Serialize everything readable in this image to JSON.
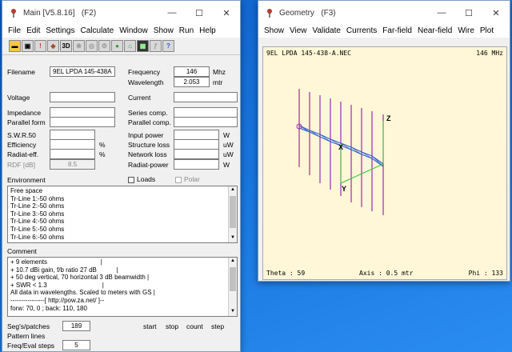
{
  "main": {
    "title": "Main [V5.8.16]",
    "shortcut": "(F2)",
    "menu": [
      "File",
      "Edit",
      "Settings",
      "Calculate",
      "Window",
      "Show",
      "Run",
      "Help"
    ],
    "toolbar_icons": [
      "open-icon",
      "save-icon",
      "info-icon",
      "snapshot-icon",
      "3d-icon",
      "pattern-icon",
      "sweep-icon",
      "gear-icon",
      "sphere-icon",
      "home-icon",
      "grid-icon",
      "tool-icon",
      "help-icon"
    ],
    "toolbar_3d_label": "3D",
    "filename_label": "Filename",
    "filename_value": "9EL LPDA 145-438A",
    "frequency_label": "Frequency",
    "frequency_value": "146",
    "frequency_unit": "Mhz",
    "wavelength_label": "Wavelength",
    "wavelength_value": "2.053",
    "wavelength_unit": "mtr",
    "voltage_label": "Voltage",
    "current_label": "Current",
    "impedance_label": "Impedance",
    "series_comp_label": "Series comp.",
    "parallel_form_label": "Parallel form",
    "parallel_comp_label": "Parallel comp.",
    "swr_label": "S.W.R.50",
    "input_power_label": "Input power",
    "input_power_unit": "W",
    "efficiency_label": "Efficiency",
    "efficiency_unit": "%",
    "structure_loss_label": "Structure loss",
    "structure_loss_unit": "uW",
    "radiat_eff_label": "Radiat-eff.",
    "radiat_eff_unit": "%",
    "network_loss_label": "Network loss",
    "network_loss_unit": "uW",
    "rdf_label": "RDF [dB]",
    "rdf_value": "8.5",
    "radiat_power_label": "Radiat-power",
    "radiat_power_unit": "W",
    "environment_label": "Environment",
    "loads_label": "Loads",
    "polar_label": "Polar",
    "environment_lines": [
      "Free space",
      "Tr-Line  1:-50 ohms",
      "Tr-Line  2:-50 ohms",
      "Tr-Line  3:-50 ohms",
      "Tr-Line  4:-50 ohms",
      "Tr-Line  5:-50 ohms",
      "Tr-Line  6:-50 ohms"
    ],
    "comment_label": "Comment",
    "comment_lines": [
      "+ 9 elements                              |",
      "+ 10.7 dBi gain, f/b ratio 27 dB           |",
      "+ 50 deg vertical, 70 horizontal 3 dB beamwidth |",
      "+ SWR < 1.3                               |",
      "All data in wavelengths. Scaled to meters with GS |",
      "----------------[ http://pow.za.net/ ]--",
      "forw: 70, 0 ; back: 110, 180"
    ],
    "segs_label": "Seg's/patches",
    "segs_value": "189",
    "pattern_lines_label": "Pattern lines",
    "freq_eval_label": "Freq/Eval steps",
    "freq_eval_value": "5",
    "start_label": "start",
    "stop_label": "stop",
    "count_label": "count",
    "step_label": "step"
  },
  "geometry": {
    "title": "Geometry",
    "shortcut": "(F3)",
    "menu": [
      "Show",
      "View",
      "Validate",
      "Currents",
      "Far-field",
      "Near-field",
      "Wire",
      "Plot"
    ],
    "canvas_title": "9EL LPDA 145-438-A.NEC",
    "canvas_freq": "146 MHz",
    "theta_label": "Theta : 59",
    "axis_label": "Axis : 0.5 mtr",
    "phi_label": "Phi : 133",
    "axis_z": "Z",
    "axis_x": "X",
    "axis_y": "Y"
  },
  "colors": {
    "element_wire": "#9b2bb5",
    "boom_wire": "#2a5fd0",
    "axis_line": "#3cc23c",
    "canvas_bg": "#fff7d7"
  }
}
